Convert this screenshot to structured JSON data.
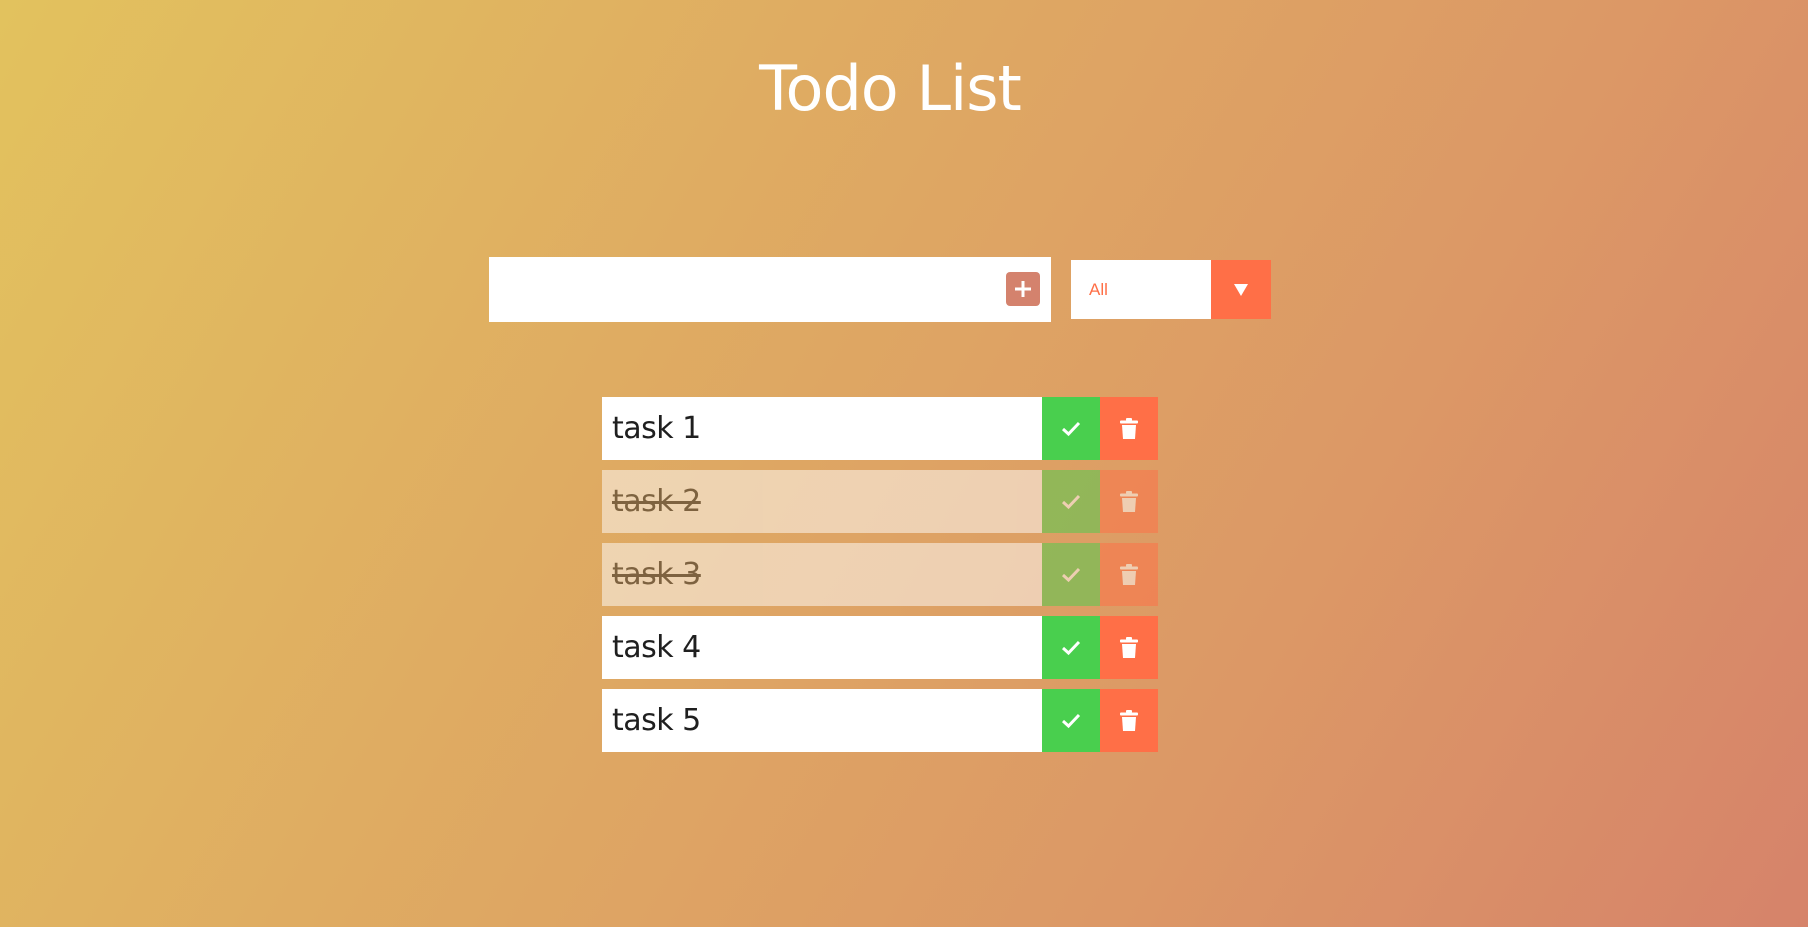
{
  "title": "Todo List",
  "add_form": {
    "input_value": "",
    "add_icon": "plus-icon"
  },
  "filter": {
    "selected": "All",
    "arrow_icon": "caret-down-icon"
  },
  "todos": [
    {
      "text": "task 1",
      "completed": false
    },
    {
      "text": "task 2",
      "completed": true
    },
    {
      "text": "task 3",
      "completed": true
    },
    {
      "text": "task 4",
      "completed": false
    },
    {
      "text": "task 5",
      "completed": false
    }
  ],
  "colors": {
    "check": "#49cf4e",
    "trash": "#ff6f47",
    "add_button": "#d4826d",
    "filter_text": "#ff6f47"
  }
}
